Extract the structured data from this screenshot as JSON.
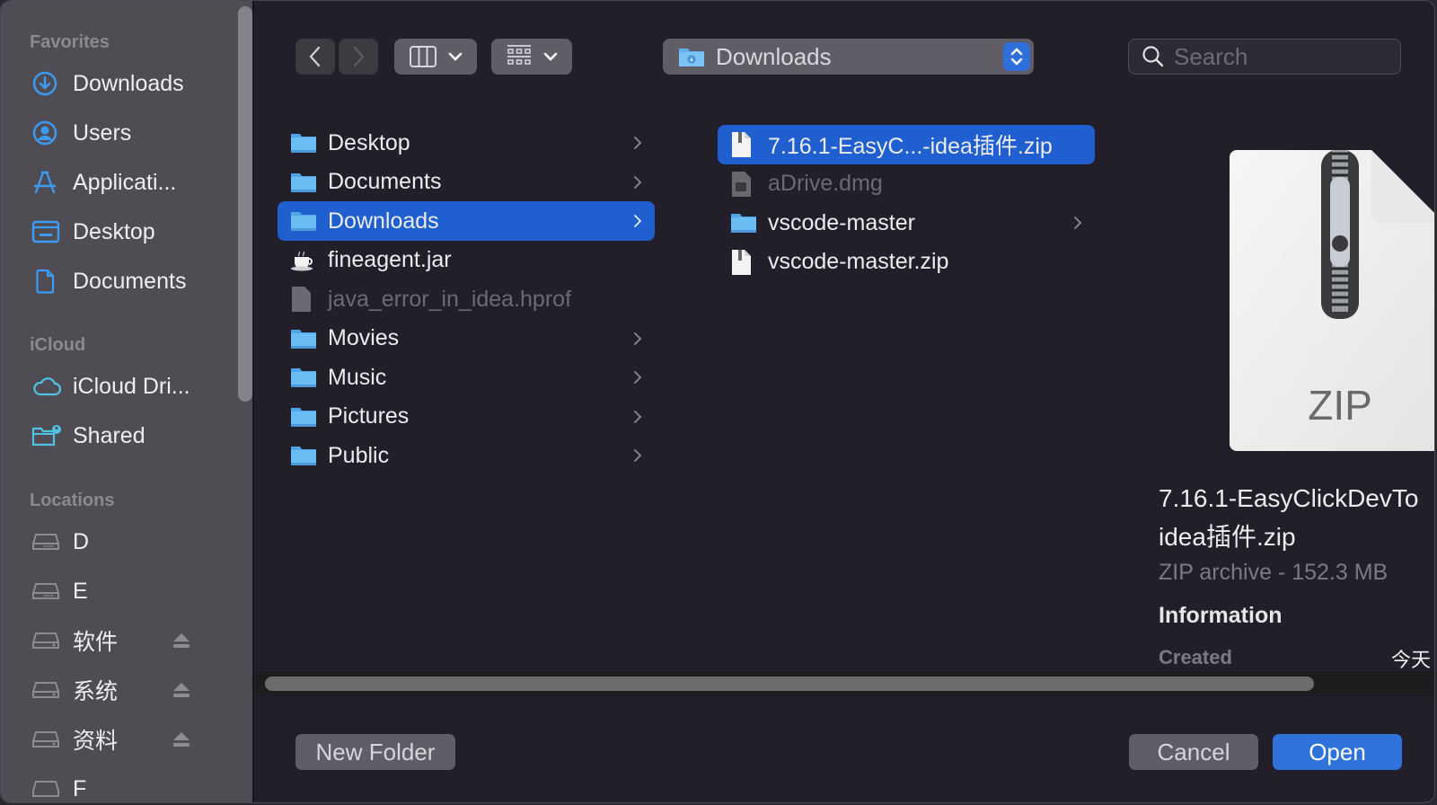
{
  "sidebar": {
    "sections": [
      {
        "title": "Favorites",
        "items": [
          {
            "label": "Downloads",
            "icon": "download-circle-icon"
          },
          {
            "label": "Users",
            "icon": "user-circle-icon"
          },
          {
            "label": "Applicati...",
            "icon": "applications-icon"
          },
          {
            "label": "Desktop",
            "icon": "desktop-icon"
          },
          {
            "label": "Documents",
            "icon": "document-icon"
          }
        ]
      },
      {
        "title": "iCloud",
        "items": [
          {
            "label": "iCloud Dri...",
            "icon": "cloud-icon"
          },
          {
            "label": "Shared",
            "icon": "shared-folder-icon"
          }
        ]
      },
      {
        "title": "Locations",
        "items": [
          {
            "label": "D",
            "icon": "drive-icon"
          },
          {
            "label": "E",
            "icon": "drive-icon"
          },
          {
            "label": "软件",
            "icon": "external-drive-icon",
            "eject": true
          },
          {
            "label": "系统",
            "icon": "external-drive-icon",
            "eject": true
          },
          {
            "label": "资料",
            "icon": "external-drive-icon",
            "eject": true
          },
          {
            "label": "F",
            "icon": "drive-icon"
          }
        ]
      }
    ]
  },
  "toolbar": {
    "back_icon": "chevron-left-icon",
    "forward_icon": "chevron-right-icon",
    "view_mode_icon": "columns-view-icon",
    "group_icon": "grid-group-icon",
    "location": "Downloads",
    "search_placeholder": "Search"
  },
  "columns": [
    {
      "items": [
        {
          "label": "Desktop",
          "kind": "folder",
          "has_children": true
        },
        {
          "label": "Documents",
          "kind": "folder",
          "has_children": true
        },
        {
          "label": "Downloads",
          "kind": "folder",
          "has_children": true,
          "selected": true
        },
        {
          "label": "fineagent.jar",
          "kind": "jar"
        },
        {
          "label": "java_error_in_idea.hprof",
          "kind": "file",
          "disabled": true
        },
        {
          "label": "Movies",
          "kind": "folder",
          "has_children": true
        },
        {
          "label": "Music",
          "kind": "folder",
          "has_children": true
        },
        {
          "label": "Pictures",
          "kind": "folder",
          "has_children": true
        },
        {
          "label": "Public",
          "kind": "folder",
          "has_children": true
        }
      ]
    },
    {
      "items": [
        {
          "label": "7.16.1-EasyC...-idea插件.zip",
          "kind": "zip",
          "selected": true
        },
        {
          "label": "aDrive.dmg",
          "kind": "dmg",
          "disabled": true
        },
        {
          "label": "vscode-master",
          "kind": "folder",
          "has_children": true
        },
        {
          "label": "vscode-master.zip",
          "kind": "zip"
        }
      ]
    }
  ],
  "preview": {
    "icon_label": "ZIP",
    "name_line1": "7.16.1-EasyClickDevTo",
    "name_line2": "idea插件.zip",
    "kind": "ZIP archive - 152.3 MB",
    "info_heading": "Information",
    "created_label": "Created",
    "created_value": "今天"
  },
  "buttons": {
    "new_folder": "New Folder",
    "cancel": "Cancel",
    "open": "Open"
  },
  "colors": {
    "accent": "#2f72da",
    "selection": "#1f5fd0",
    "sidebar_icon": "#3d9bf5",
    "icloud_icon": "#4fc3e6"
  }
}
